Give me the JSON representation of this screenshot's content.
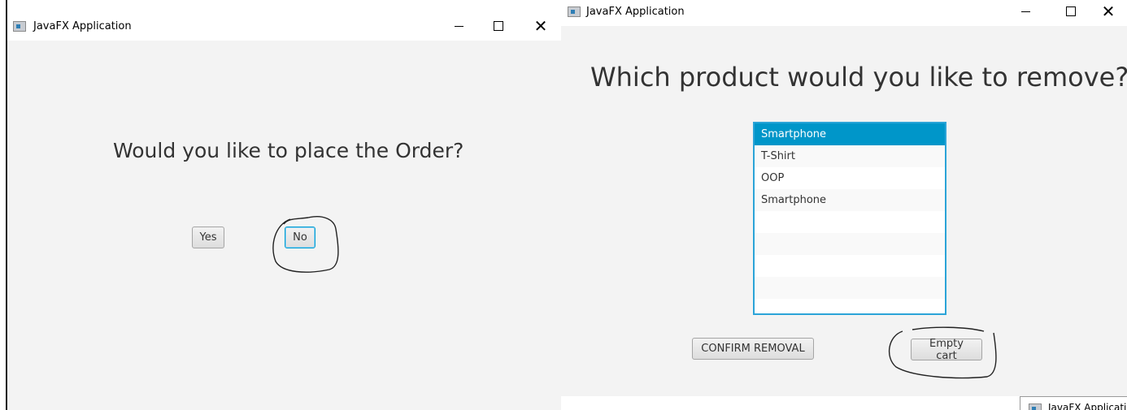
{
  "window_left": {
    "title": "JavaFX Application",
    "heading": "Would you like to place the Order?",
    "yes_label": "Yes",
    "no_label": "No"
  },
  "window_right": {
    "title": "JavaFX Application",
    "heading": "Which product would you like to remove?",
    "products": [
      "Smartphone",
      "T-Shirt",
      "OOP",
      "Smartphone"
    ],
    "selected_index": 0,
    "confirm_label": "CONFIRM REMOVAL",
    "empty_label": "Empty cart"
  },
  "taskbar": {
    "label": "JavaFX Applicati"
  },
  "colors": {
    "selection": "#0096c9",
    "focus_border": "#039ed3",
    "window_bg": "#f3f3f3"
  },
  "icons": {
    "app": "javafx-app-icon",
    "minimize": "minimize-icon",
    "maximize": "maximize-icon",
    "close": "close-icon"
  }
}
